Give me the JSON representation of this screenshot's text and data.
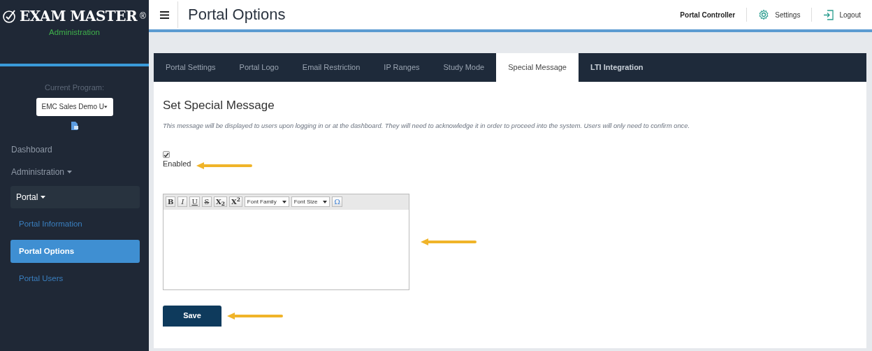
{
  "sidebar": {
    "logo": {
      "brand": "EXAM MASTER",
      "registered": "®",
      "subtitle": "Administration"
    },
    "program": {
      "label": "Current Program:",
      "value": "EMC Sales Demo U"
    },
    "items": [
      {
        "label": "Dashboard"
      },
      {
        "label": "Administration",
        "expanded": false
      },
      {
        "label": "Portal",
        "expanded": true,
        "children": [
          {
            "label": "Portal Information",
            "selected": false
          },
          {
            "label": "Portal Options",
            "selected": true
          },
          {
            "label": "Portal Users",
            "selected": false
          }
        ]
      }
    ]
  },
  "header": {
    "title": "Portal Options",
    "user": "Portal Controller",
    "links": [
      {
        "kind": "settings",
        "label": "Settings"
      },
      {
        "kind": "logout",
        "label": "Logout"
      }
    ]
  },
  "tabs": [
    {
      "label": "Portal Settings",
      "selected": false
    },
    {
      "label": "Portal Logo",
      "selected": false
    },
    {
      "label": "Email Restriction",
      "selected": false
    },
    {
      "label": "IP Ranges",
      "selected": false
    },
    {
      "label": "Study Mode",
      "selected": false
    },
    {
      "label": "Special Message",
      "selected": true
    },
    {
      "label": "LTI Integration",
      "selected": false
    }
  ],
  "panel": {
    "heading": "Set Special Message",
    "description": "This message will be displayed to users upon logging in or at the dashboard. They will need to acknowledge it in order to proceed into the system. Users will only need to confirm once.",
    "enabled": {
      "label": "Enabled",
      "checked": true
    },
    "editor": {
      "toolbar": [
        {
          "kind": "button",
          "label": "B"
        },
        {
          "kind": "button",
          "label": "I"
        },
        {
          "kind": "button",
          "label": "U"
        },
        {
          "kind": "button",
          "label": "S"
        },
        {
          "kind": "button",
          "label": "X$_{2}$"
        },
        {
          "kind": "button",
          "label": "X$^{2}$"
        },
        {
          "kind": "select",
          "label": "Font Family"
        },
        {
          "kind": "select",
          "label": "Font Size"
        },
        {
          "kind": "button",
          "label": "Ω"
        }
      ]
    },
    "save": "Save"
  }
}
